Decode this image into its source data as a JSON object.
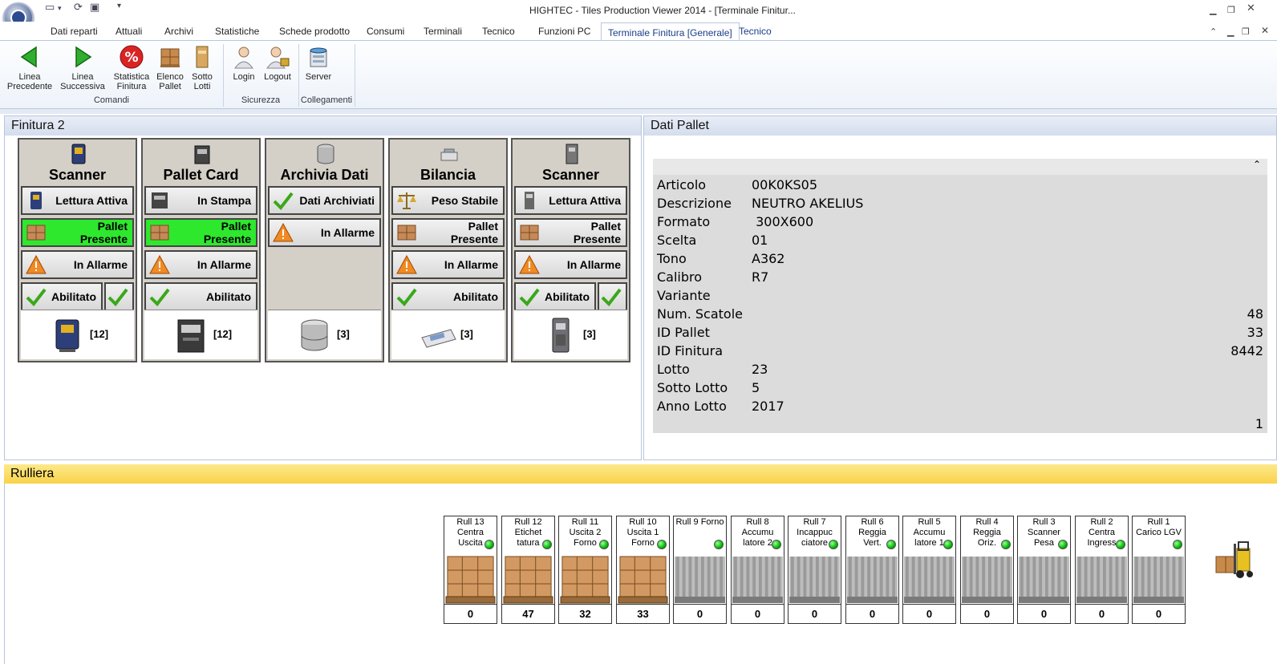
{
  "window": {
    "title": "HIGHTEC - Tiles Production Viewer 2014 - [Terminale Finitur..."
  },
  "tabs": [
    {
      "label": "Dati reparti"
    },
    {
      "label": "Attuali"
    },
    {
      "label": "Archivi"
    },
    {
      "label": "Statistiche"
    },
    {
      "label": "Schede prodotto"
    },
    {
      "label": "Consumi"
    },
    {
      "label": "Terminali"
    },
    {
      "label": "Tecnico"
    },
    {
      "label": "Funzioni PC"
    },
    {
      "label": "Terminale Finitura [Generale]"
    },
    {
      "label": "Tecnico"
    }
  ],
  "ribbon": {
    "comandi": {
      "label": "Comandi",
      "buttons": [
        "Linea\nPrecedente",
        "Linea\nSuccessiva",
        "Statistica\nFinitura",
        "Elenco\nPallet",
        "Sotto\nLotti"
      ]
    },
    "sicurezza": {
      "label": "Sicurezza",
      "buttons": [
        "Login",
        "Logout"
      ]
    },
    "collegamenti": {
      "label": "Collegamenti",
      "buttons": [
        "Server"
      ]
    }
  },
  "finitura": {
    "title": "Finitura 2",
    "devices": [
      {
        "name": "Scanner",
        "states": [
          "Lettura Attiva",
          "Pallet\nPresente",
          "In Allarme",
          "Abilitato"
        ],
        "green": [
          1
        ],
        "count": "[12]"
      },
      {
        "name": "Pallet Card",
        "states": [
          "In Stampa",
          "Pallet\nPresente",
          "In Allarme",
          "Abilitato"
        ],
        "green": [
          1
        ],
        "count": "[12]"
      },
      {
        "name": "Archivia Dati",
        "states": [
          "Dati Archiviati",
          "In Allarme"
        ],
        "green": [],
        "count": "[3]"
      },
      {
        "name": "Bilancia",
        "states": [
          "Peso Stabile",
          "Pallet\nPresente",
          "In Allarme",
          "Abilitato"
        ],
        "green": [],
        "count": "[3]"
      },
      {
        "name": "Scanner",
        "states": [
          "Lettura Attiva",
          "Pallet\nPresente",
          "In Allarme",
          "Abilitato"
        ],
        "green": [],
        "count": "[3]"
      }
    ]
  },
  "dati_pallet": {
    "title": "Dati Pallet",
    "fields": [
      {
        "k": "Articolo",
        "v": "00K0KS05"
      },
      {
        "k": "Descrizione",
        "v": "NEUTRO AKELIUS"
      },
      {
        "k": "Formato",
        "v": " 300X600"
      },
      {
        "k": "Scelta",
        "v": "01"
      },
      {
        "k": "Tono",
        "v": "A362"
      },
      {
        "k": "Calibro",
        "v": "R7"
      },
      {
        "k": "Variante",
        "v": ""
      },
      {
        "k": "Num. Scatole",
        "vr": "48"
      },
      {
        "k": "ID Pallet",
        "vr": "33"
      },
      {
        "k": "ID Finitura",
        "vr": "8442"
      },
      {
        "k": "Lotto",
        "v": "23"
      },
      {
        "k": "Sotto Lotto",
        "v": "5"
      },
      {
        "k": "Anno Lotto",
        "v": "2017"
      }
    ],
    "footer": "1"
  },
  "rulliera": {
    "title": "Rulliera",
    "rulli": [
      {
        "label": "Rull 13\nCentra\nUscita",
        "value": "0",
        "pallet": true
      },
      {
        "label": "Rull 12\nEtichet\ntatura",
        "value": "47",
        "pallet": true
      },
      {
        "label": "Rull 11\nUscita 2\nForno",
        "value": "32",
        "pallet": true
      },
      {
        "label": "Rull 10\nUscita 1\nForno",
        "value": "33",
        "pallet": true
      },
      {
        "label": "Rull 9 Forno",
        "value": "0",
        "pallet": false
      },
      {
        "label": "Rull 8\nAccumu\nlatore 2",
        "value": "0",
        "pallet": false
      },
      {
        "label": "Rull 7\nIncappuc\nciatore",
        "value": "0",
        "pallet": false
      },
      {
        "label": "Rull 6\nReggia\nVert.",
        "value": "0",
        "pallet": false
      },
      {
        "label": "Rull 5\nAccumu\nlatore 1",
        "value": "0",
        "pallet": false
      },
      {
        "label": "Rull 4\nReggia\nOriz.",
        "value": "0",
        "pallet": false
      },
      {
        "label": "Rull 3\nScanner\nPesa",
        "value": "0",
        "pallet": false
      },
      {
        "label": "Rull 2\nCentra\nIngress",
        "value": "0",
        "pallet": false
      },
      {
        "label": "Rull 1\nCarico LGV",
        "value": "0",
        "pallet": false
      }
    ]
  }
}
